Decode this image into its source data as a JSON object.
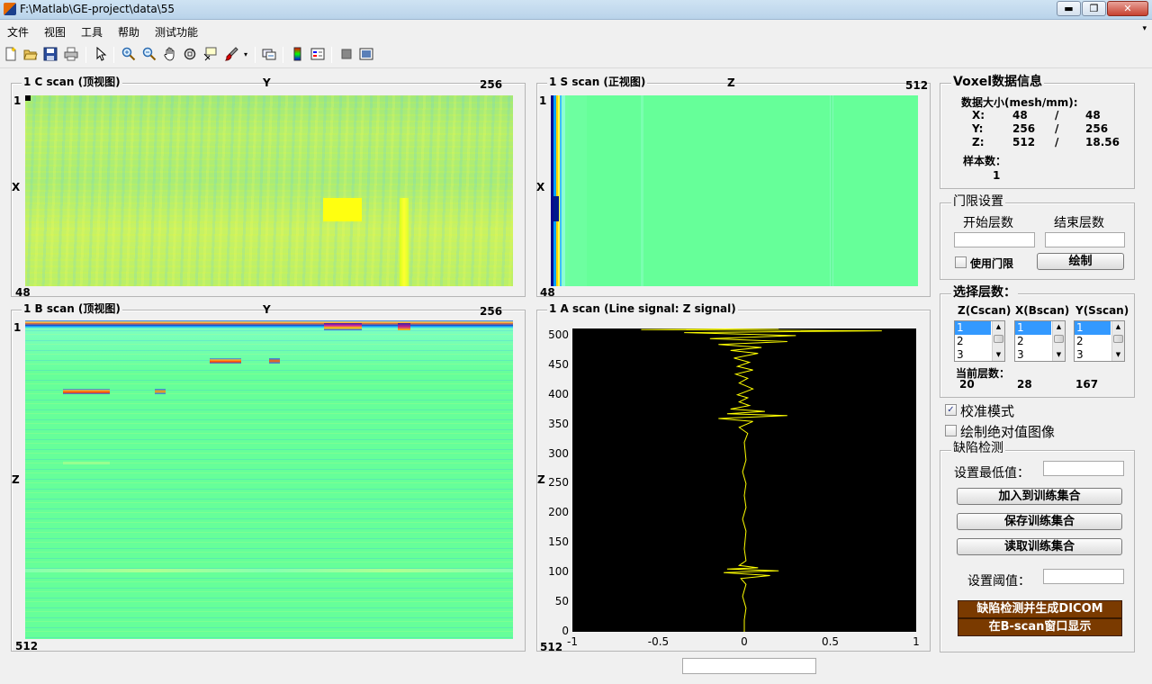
{
  "window": {
    "title": "F:\\Matlab\\GE-project\\data\\55",
    "minimize": "▬",
    "maximize": "❐",
    "close": "✕"
  },
  "menu": [
    "文件",
    "视图",
    "工具",
    "帮助",
    "测试功能"
  ],
  "toolbar_icons": [
    "new-file-icon",
    "open-folder-icon",
    "save-icon",
    "print-icon",
    "select-arrow-icon",
    "zoom-in-icon",
    "zoom-out-icon",
    "pan-hand-icon",
    "rotate-3d-icon",
    "data-cursor-icon",
    "brush-icon",
    "link-plot-icon",
    "colorbar-icon",
    "legend-icon",
    "hide-plot-tools-icon",
    "show-plot-tools-icon"
  ],
  "cscan": {
    "title": "1 C scan (顶视图)",
    "x_axis_label": "Y",
    "x_max": "256",
    "y_axis_label": "X",
    "y_min": "1",
    "y_max": "48"
  },
  "sscan": {
    "title": "1 S scan (正视图)",
    "x_axis_label": "Z",
    "x_max": "512",
    "y_axis_label": "X",
    "y_min": "1",
    "y_max": "48"
  },
  "bscan": {
    "title": "1 B scan (顶视图)",
    "x_axis_label": "Y",
    "x_max": "256",
    "y_axis_label": "Z",
    "y_min": "1",
    "y_max": "512"
  },
  "ascan": {
    "title": "1 A scan (Line signal: Z signal)",
    "y_axis_label": "Z",
    "y_extra_label": "512",
    "y_ticks": [
      "500",
      "450",
      "400",
      "350",
      "300",
      "250",
      "200",
      "150",
      "100",
      "50",
      "0"
    ],
    "x_ticks": [
      "-1",
      "-0.5",
      "0",
      "0.5",
      "1"
    ]
  },
  "chart_data": {
    "type": "line",
    "title": "1 A scan (Line signal: Z signal)",
    "xlabel": "",
    "ylabel": "Z",
    "xlim": [
      -1,
      1
    ],
    "ylim": [
      0,
      512
    ],
    "series": [
      {
        "name": "Z signal",
        "color": "#ffff00",
        "points": [
          [
            0,
            0
          ],
          [
            0,
            20
          ],
          [
            0.01,
            40
          ],
          [
            -0.01,
            60
          ],
          [
            0.01,
            80
          ],
          [
            -0.02,
            90
          ],
          [
            0.15,
            95
          ],
          [
            -0.12,
            100
          ],
          [
            0.2,
            103
          ],
          [
            -0.1,
            106
          ],
          [
            0.08,
            108
          ],
          [
            -0.03,
            112
          ],
          [
            0.01,
            120
          ],
          [
            0,
            140
          ],
          [
            0.01,
            170
          ],
          [
            -0.01,
            190
          ],
          [
            0.01,
            210
          ],
          [
            0,
            230
          ],
          [
            0.01,
            250
          ],
          [
            -0.01,
            270
          ],
          [
            0.01,
            290
          ],
          [
            0,
            320
          ],
          [
            0.02,
            335
          ],
          [
            -0.03,
            345
          ],
          [
            0.05,
            355
          ],
          [
            -0.15,
            360
          ],
          [
            0.25,
            365
          ],
          [
            -0.1,
            368
          ],
          [
            0.12,
            372
          ],
          [
            -0.08,
            376
          ],
          [
            0.03,
            382
          ],
          [
            -0.03,
            388
          ],
          [
            0.02,
            395
          ],
          [
            -0.04,
            400
          ],
          [
            0.05,
            410
          ],
          [
            -0.03,
            420
          ],
          [
            0.02,
            428
          ],
          [
            -0.05,
            435
          ],
          [
            0.05,
            442
          ],
          [
            -0.04,
            448
          ],
          [
            0.03,
            455
          ],
          [
            -0.06,
            462
          ],
          [
            0.08,
            470
          ],
          [
            -0.08,
            475
          ],
          [
            0.1,
            480
          ],
          [
            -0.15,
            485
          ],
          [
            0.25,
            490
          ],
          [
            -0.2,
            495
          ],
          [
            0.3,
            500
          ],
          [
            -0.35,
            505
          ],
          [
            0.8,
            508
          ],
          [
            -0.6,
            510
          ],
          [
            0.2,
            512
          ]
        ]
      }
    ]
  },
  "voxel_info": {
    "title": "Voxel数据信息",
    "size_label": "数据大小(mesh/mm):",
    "rows": [
      {
        "axis": "X:",
        "mesh": "48",
        "sep": "/",
        "mm": "48"
      },
      {
        "axis": "Y:",
        "mesh": "256",
        "sep": "/",
        "mm": "256"
      },
      {
        "axis": "Z:",
        "mesh": "512",
        "sep": "/",
        "mm": "18.56"
      }
    ],
    "sample_label": "样本数：",
    "sample_value": "1"
  },
  "gate": {
    "title": "门限设置",
    "start_label": "开始层数",
    "end_label": "结束层数",
    "start_value": "",
    "end_value": "",
    "use_gate_label": "使用门限",
    "draw_button": "绘制"
  },
  "layer_select": {
    "title": "选择层数：",
    "columns": [
      {
        "header": "Z(Cscan)",
        "options": [
          "1",
          "2",
          "3"
        ],
        "current": "20"
      },
      {
        "header": "X(Bscan)",
        "options": [
          "1",
          "2",
          "3"
        ],
        "current": "28"
      },
      {
        "header": "Y(Sscan)",
        "options": [
          "1",
          "2",
          "3"
        ],
        "current": "167"
      }
    ],
    "current_label": "当前层数："
  },
  "calibration_mode": {
    "label": "校准模式",
    "checked": true,
    "mark": "✓"
  },
  "abs_image": {
    "label": "绘制绝对值图像",
    "checked": false
  },
  "defect": {
    "title": "缺陷检测",
    "min_label": "设置最低值：",
    "min_value": "",
    "add_button": "加入到训练集合",
    "save_button": "保存训练集合",
    "load_button": "读取训练集合",
    "threshold_label": "设置阈值：",
    "threshold_value": "",
    "detect_button": "缺陷检测并生成DICOM",
    "show_button": "在B-scan窗口显示"
  },
  "status_field": ""
}
